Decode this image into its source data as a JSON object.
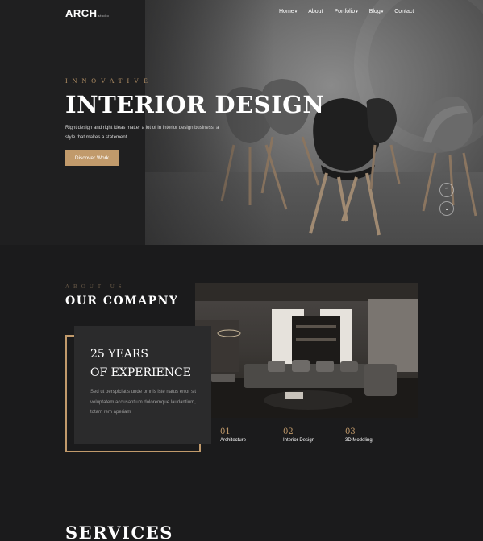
{
  "brand": {
    "name": "ARCH",
    "tagline": "studio"
  },
  "nav": {
    "items": [
      {
        "label": "Home",
        "dropdown": true
      },
      {
        "label": "About",
        "dropdown": false
      },
      {
        "label": "Portfolio",
        "dropdown": true
      },
      {
        "label": "Blog",
        "dropdown": true
      },
      {
        "label": "Contact",
        "dropdown": false
      }
    ],
    "caret": "▾"
  },
  "hero": {
    "eyebrow": "INNOVATIVE",
    "title": "INTERIOR DESIGN",
    "description": "Right design and right ideas matter a lot of in interior design business. a style that makes a statement.",
    "button_label": "Discover Work",
    "prev_icon": "chevron-up-icon",
    "next_icon": "chevron-down-icon",
    "prev_glyph": "⌃",
    "next_glyph": "⌄"
  },
  "about": {
    "eyebrow": "ABOUT US",
    "title": "OUR COMAPNY",
    "experience_title_line1": "25 YEARS",
    "experience_title_line2": "OF EXPERIENCE",
    "experience_text": "Sed ut perspiciatis unde omnis iste natus error sit voluptatem accusantium doloremque laudantium, totam rem aperiam",
    "features": [
      {
        "num": "01",
        "label": "Architecture"
      },
      {
        "num": "02",
        "label": "Interior Design"
      },
      {
        "num": "03",
        "label": "3D Modeling"
      }
    ]
  },
  "services": {
    "title": "SERVICES"
  },
  "colors": {
    "accent": "#c19a6b",
    "background": "#1b1b1c",
    "card": "#2b2b2c"
  }
}
